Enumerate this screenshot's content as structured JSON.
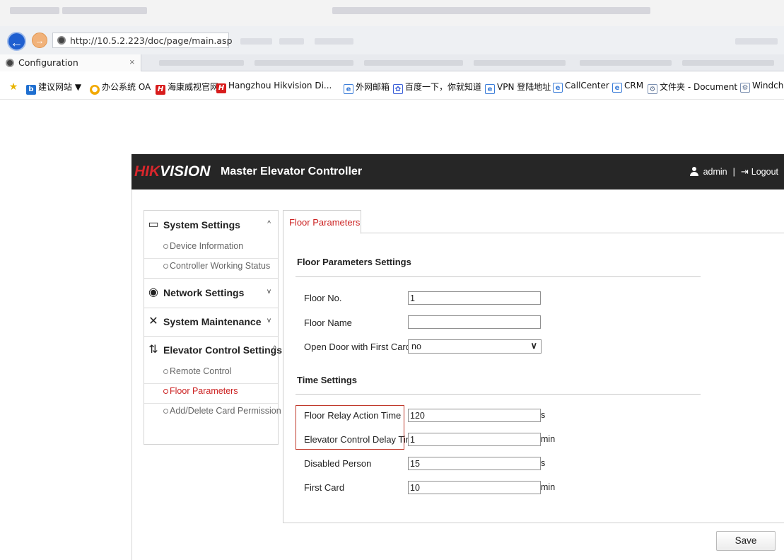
{
  "browser": {
    "url": "http://10.5.2.223/doc/page/main.asp",
    "tab_title": "Configuration",
    "tab_close": "×",
    "favorites": [
      {
        "icon": "b",
        "label": "建议网站 ▼"
      },
      {
        "icon": "oa",
        "label": "办公系统 OA"
      },
      {
        "icon": "h",
        "label": "海康威视官网"
      },
      {
        "icon": "h",
        "label": "Hangzhou Hikvision Di..."
      },
      {
        "icon": "e",
        "label": "外网邮箱"
      },
      {
        "icon": "baidu",
        "label": "百度一下，你就知道"
      },
      {
        "icon": "e",
        "label": "VPN 登陆地址"
      },
      {
        "icon": "e",
        "label": "CallCenter"
      },
      {
        "icon": "e",
        "label": "CRM"
      },
      {
        "icon": "gear",
        "label": "文件夹 - Document"
      },
      {
        "icon": "gear",
        "label": "Windchi"
      }
    ]
  },
  "header": {
    "logo_hik": "HIK",
    "logo_vision": "VISION",
    "title": "Master Elevator Controller",
    "user": "admin",
    "separator": "|",
    "logout": "Logout"
  },
  "sidebar": {
    "system_settings": "System Settings",
    "device_information": "Device Information",
    "controller_working_status": "Controller Working Status",
    "network_settings": "Network Settings",
    "system_maintenance": "System Maintenance",
    "elevator_control_settings": "Elevator Control Settings",
    "remote_control": "Remote Control",
    "floor_parameters": "Floor Parameters",
    "add_delete_card_permission": "Add/Delete Card Permission"
  },
  "main": {
    "tab": "Floor Parameters",
    "floor_section_title": "Floor Parameters Settings",
    "floor_no_label": "Floor No.",
    "floor_no_value": "1",
    "floor_name_label": "Floor Name",
    "floor_name_value": "",
    "open_door_label": "Open Door with First Card",
    "open_door_value": "no",
    "time_section_title": "Time Settings",
    "relay_time_label": "Floor Relay Action Time",
    "relay_time_value": "120",
    "relay_time_unit": "s",
    "delay_time_label": "Elevator Control Delay Time",
    "delay_time_value": "1",
    "delay_time_unit": "min",
    "disabled_person_label": "Disabled Person",
    "disabled_person_value": "15",
    "disabled_person_unit": "s",
    "first_card_label": "First Card",
    "first_card_value": "10",
    "first_card_unit": "min",
    "save_label": "Save"
  },
  "colors": {
    "header_bg": "#262626",
    "brand_red": "#d8262c",
    "active_red": "#cc2222",
    "highlight_border": "#c0392b"
  }
}
